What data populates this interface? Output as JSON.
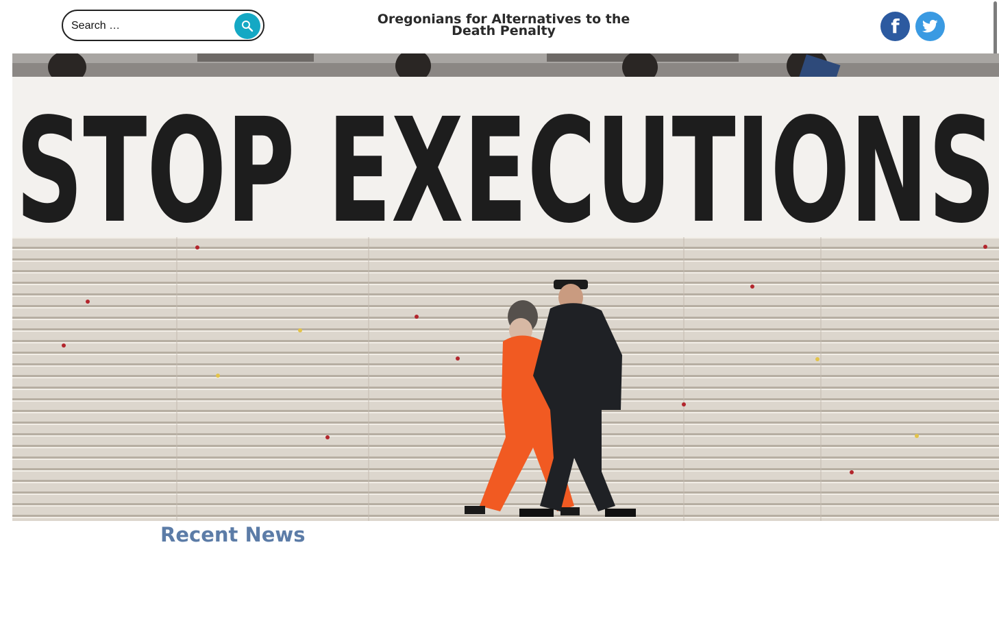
{
  "header": {
    "search": {
      "placeholder": "Search …",
      "value": ""
    },
    "site_title": "Oregonians for Alternatives to the Death Penalty",
    "social": [
      {
        "name": "facebook",
        "glyph": "f",
        "color": "#2c5aa0"
      },
      {
        "name": "twitter",
        "color": "#3a9ae2"
      }
    ]
  },
  "hero": {
    "banner_text": "STOP EXECUTIONS"
  },
  "main": {
    "section_title": "Recent News"
  },
  "colors": {
    "accent": "#14a8c4",
    "heading": "#5c7ca7"
  }
}
